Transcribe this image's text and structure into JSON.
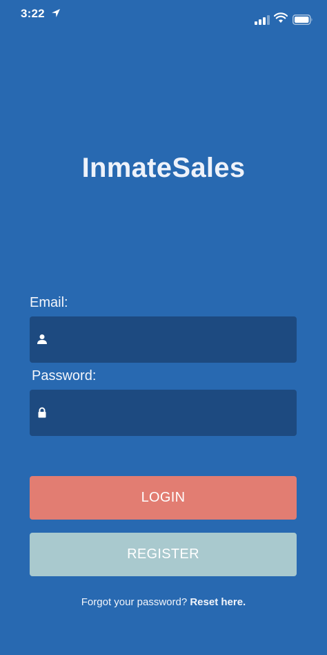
{
  "status_bar": {
    "time": "3:22",
    "icons": [
      "location-arrow-icon",
      "signal-bars-icon",
      "wifi-icon",
      "battery-icon"
    ]
  },
  "app": {
    "title": "InmateSales"
  },
  "form": {
    "email_label": "Email:",
    "email_value": "",
    "email_icon": "user-icon",
    "password_label": "Password:",
    "password_value": "",
    "password_icon": "lock-icon"
  },
  "buttons": {
    "login_label": "LOGIN",
    "register_label": "REGISTER"
  },
  "footer": {
    "forgot_text": "Forgot your password?",
    "reset_link": "Reset here."
  },
  "colors": {
    "background": "#2869b1",
    "input_background": "#1d4a80",
    "login_button": "#e27d72",
    "register_button": "#a9c9ce"
  }
}
